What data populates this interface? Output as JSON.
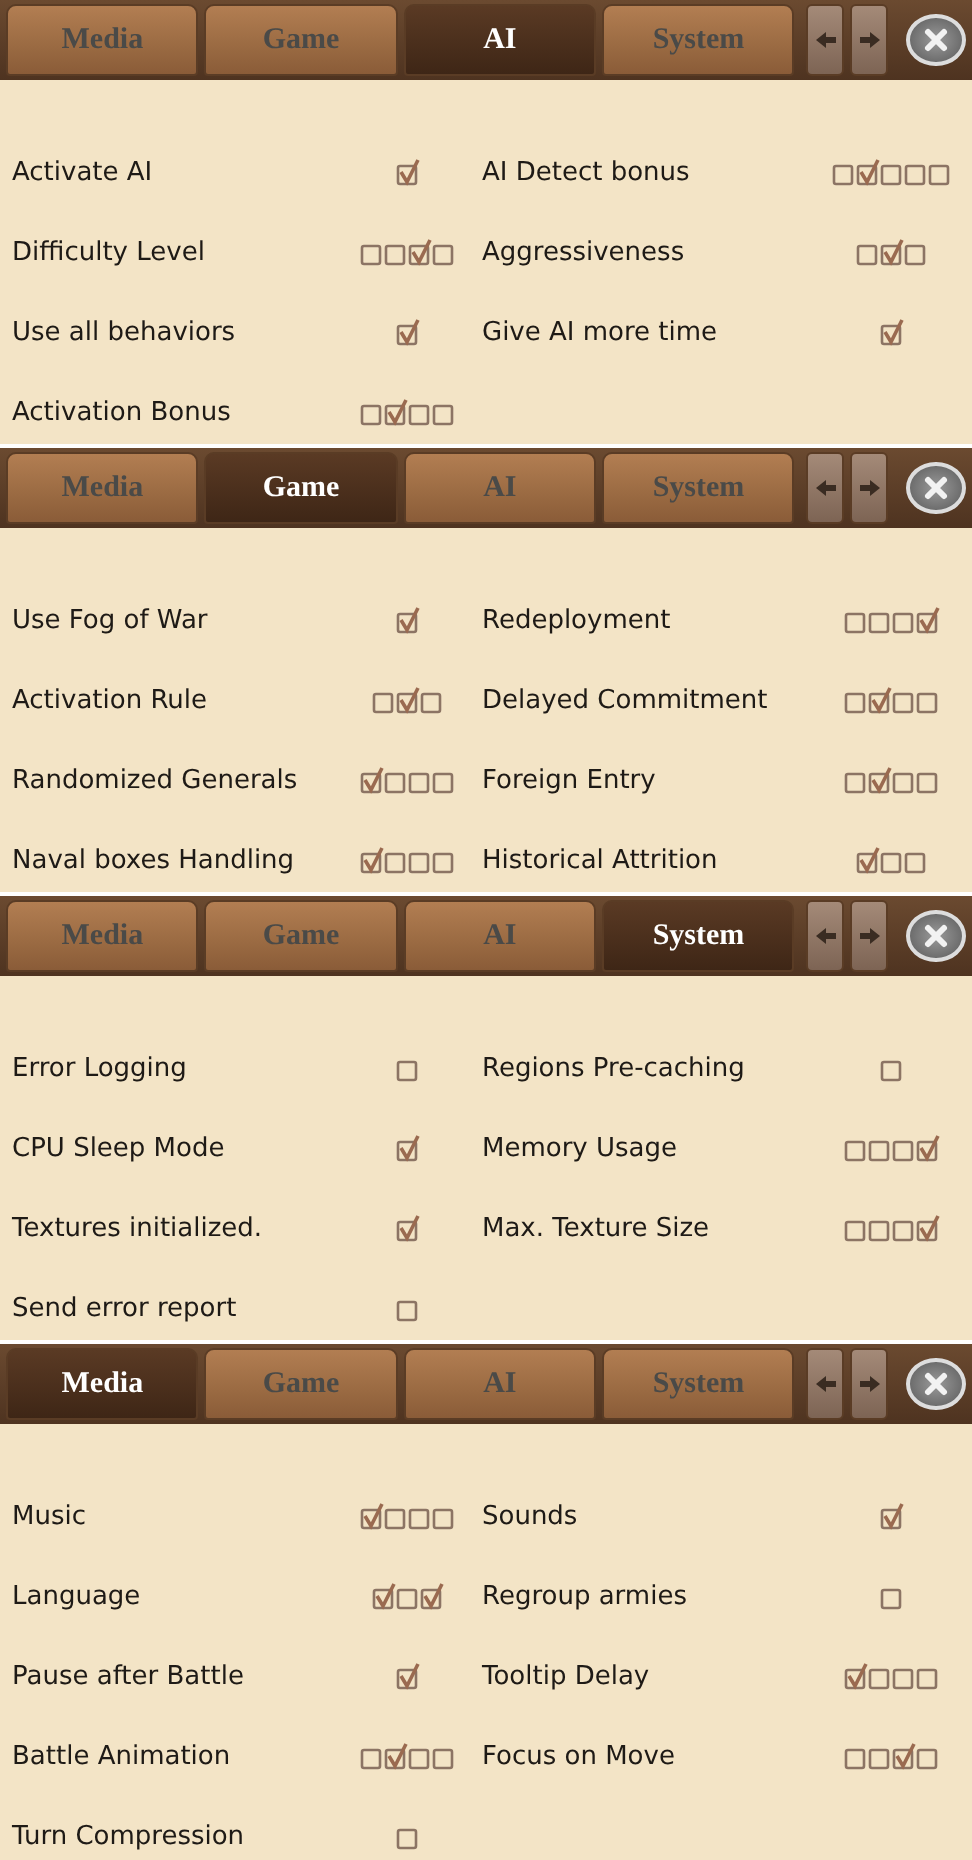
{
  "panels": [
    {
      "tabs": [
        {
          "label": "Media",
          "selected": false
        },
        {
          "label": "Game",
          "selected": false
        },
        {
          "label": "AI",
          "selected": true
        },
        {
          "label": "System",
          "selected": false
        }
      ],
      "settings": [
        {
          "label": "Activate AI",
          "boxes": [
            {
              "checked": true
            }
          ]
        },
        {
          "label": "AI Detect bonus",
          "boxes": [
            {
              "checked": false
            },
            {
              "checked": true
            },
            {
              "checked": false
            },
            {
              "checked": false
            },
            {
              "checked": false
            }
          ]
        },
        {
          "label": "Difficulty Level",
          "boxes": [
            {
              "checked": false
            },
            {
              "checked": false
            },
            {
              "checked": true
            },
            {
              "checked": false
            }
          ]
        },
        {
          "label": "Aggressiveness",
          "boxes": [
            {
              "checked": false
            },
            {
              "checked": true
            },
            {
              "checked": false
            }
          ]
        },
        {
          "label": "Use all behaviors",
          "boxes": [
            {
              "checked": true
            }
          ]
        },
        {
          "label": "Give AI more time",
          "boxes": [
            {
              "checked": true
            }
          ]
        },
        {
          "label": "Activation Bonus",
          "boxes": [
            {
              "checked": false
            },
            {
              "checked": true
            },
            {
              "checked": false
            },
            {
              "checked": false
            }
          ]
        }
      ]
    },
    {
      "tabs": [
        {
          "label": "Media",
          "selected": false
        },
        {
          "label": "Game",
          "selected": true
        },
        {
          "label": "AI",
          "selected": false
        },
        {
          "label": "System",
          "selected": false
        }
      ],
      "settings": [
        {
          "label": "Use Fog of War",
          "boxes": [
            {
              "checked": true
            }
          ]
        },
        {
          "label": "Redeployment",
          "boxes": [
            {
              "checked": false
            },
            {
              "checked": false
            },
            {
              "checked": false
            },
            {
              "checked": true
            }
          ]
        },
        {
          "label": "Activation Rule",
          "boxes": [
            {
              "checked": false
            },
            {
              "checked": true
            },
            {
              "checked": false
            }
          ]
        },
        {
          "label": "Delayed Commitment",
          "boxes": [
            {
              "checked": false
            },
            {
              "checked": true
            },
            {
              "checked": false
            },
            {
              "checked": false
            }
          ]
        },
        {
          "label": "Randomized Generals",
          "boxes": [
            {
              "checked": true
            },
            {
              "checked": false
            },
            {
              "checked": false
            },
            {
              "checked": false
            }
          ]
        },
        {
          "label": "Foreign Entry",
          "boxes": [
            {
              "checked": false
            },
            {
              "checked": true
            },
            {
              "checked": false
            },
            {
              "checked": false
            }
          ]
        },
        {
          "label": "Naval boxes Handling",
          "boxes": [
            {
              "checked": true
            },
            {
              "checked": false
            },
            {
              "checked": false
            },
            {
              "checked": false
            }
          ]
        },
        {
          "label": "Historical Attrition",
          "boxes": [
            {
              "checked": true
            },
            {
              "checked": false
            },
            {
              "checked": false
            }
          ]
        }
      ]
    },
    {
      "tabs": [
        {
          "label": "Media",
          "selected": false
        },
        {
          "label": "Game",
          "selected": false
        },
        {
          "label": "AI",
          "selected": false
        },
        {
          "label": "System",
          "selected": true
        }
      ],
      "settings": [
        {
          "label": "Error Logging",
          "boxes": [
            {
              "checked": false
            }
          ]
        },
        {
          "label": "Regions Pre-caching",
          "boxes": [
            {
              "checked": false
            }
          ]
        },
        {
          "label": "CPU Sleep Mode",
          "boxes": [
            {
              "checked": true
            }
          ]
        },
        {
          "label": "Memory Usage",
          "boxes": [
            {
              "checked": false
            },
            {
              "checked": false
            },
            {
              "checked": false
            },
            {
              "checked": true
            }
          ]
        },
        {
          "label": "Textures initialized.",
          "boxes": [
            {
              "checked": true
            }
          ]
        },
        {
          "label": "Max. Texture Size",
          "boxes": [
            {
              "checked": false
            },
            {
              "checked": false
            },
            {
              "checked": false
            },
            {
              "checked": true
            }
          ]
        },
        {
          "label": "Send error report",
          "boxes": [
            {
              "checked": false
            }
          ]
        }
      ]
    },
    {
      "tabs": [
        {
          "label": "Media",
          "selected": true
        },
        {
          "label": "Game",
          "selected": false
        },
        {
          "label": "AI",
          "selected": false
        },
        {
          "label": "System",
          "selected": false
        }
      ],
      "settings": [
        {
          "label": "Music",
          "boxes": [
            {
              "checked": true
            },
            {
              "checked": false
            },
            {
              "checked": false
            },
            {
              "checked": false
            }
          ]
        },
        {
          "label": "Sounds",
          "boxes": [
            {
              "checked": true
            }
          ]
        },
        {
          "label": "Language",
          "boxes": [
            {
              "checked": true
            },
            {
              "checked": false
            },
            {
              "checked": true
            }
          ]
        },
        {
          "label": "Regroup armies",
          "boxes": [
            {
              "checked": false
            }
          ]
        },
        {
          "label": "Pause after Battle",
          "boxes": [
            {
              "checked": true
            }
          ]
        },
        {
          "label": "Tooltip Delay",
          "boxes": [
            {
              "checked": true
            },
            {
              "checked": false
            },
            {
              "checked": false
            },
            {
              "checked": false
            }
          ]
        },
        {
          "label": "Battle Animation",
          "boxes": [
            {
              "checked": false
            },
            {
              "checked": true
            },
            {
              "checked": false
            },
            {
              "checked": false
            }
          ]
        },
        {
          "label": "Focus on Move",
          "boxes": [
            {
              "checked": false
            },
            {
              "checked": false
            },
            {
              "checked": true
            },
            {
              "checked": false
            }
          ]
        },
        {
          "label": "Turn Compression",
          "boxes": [
            {
              "checked": false
            }
          ]
        }
      ]
    }
  ]
}
